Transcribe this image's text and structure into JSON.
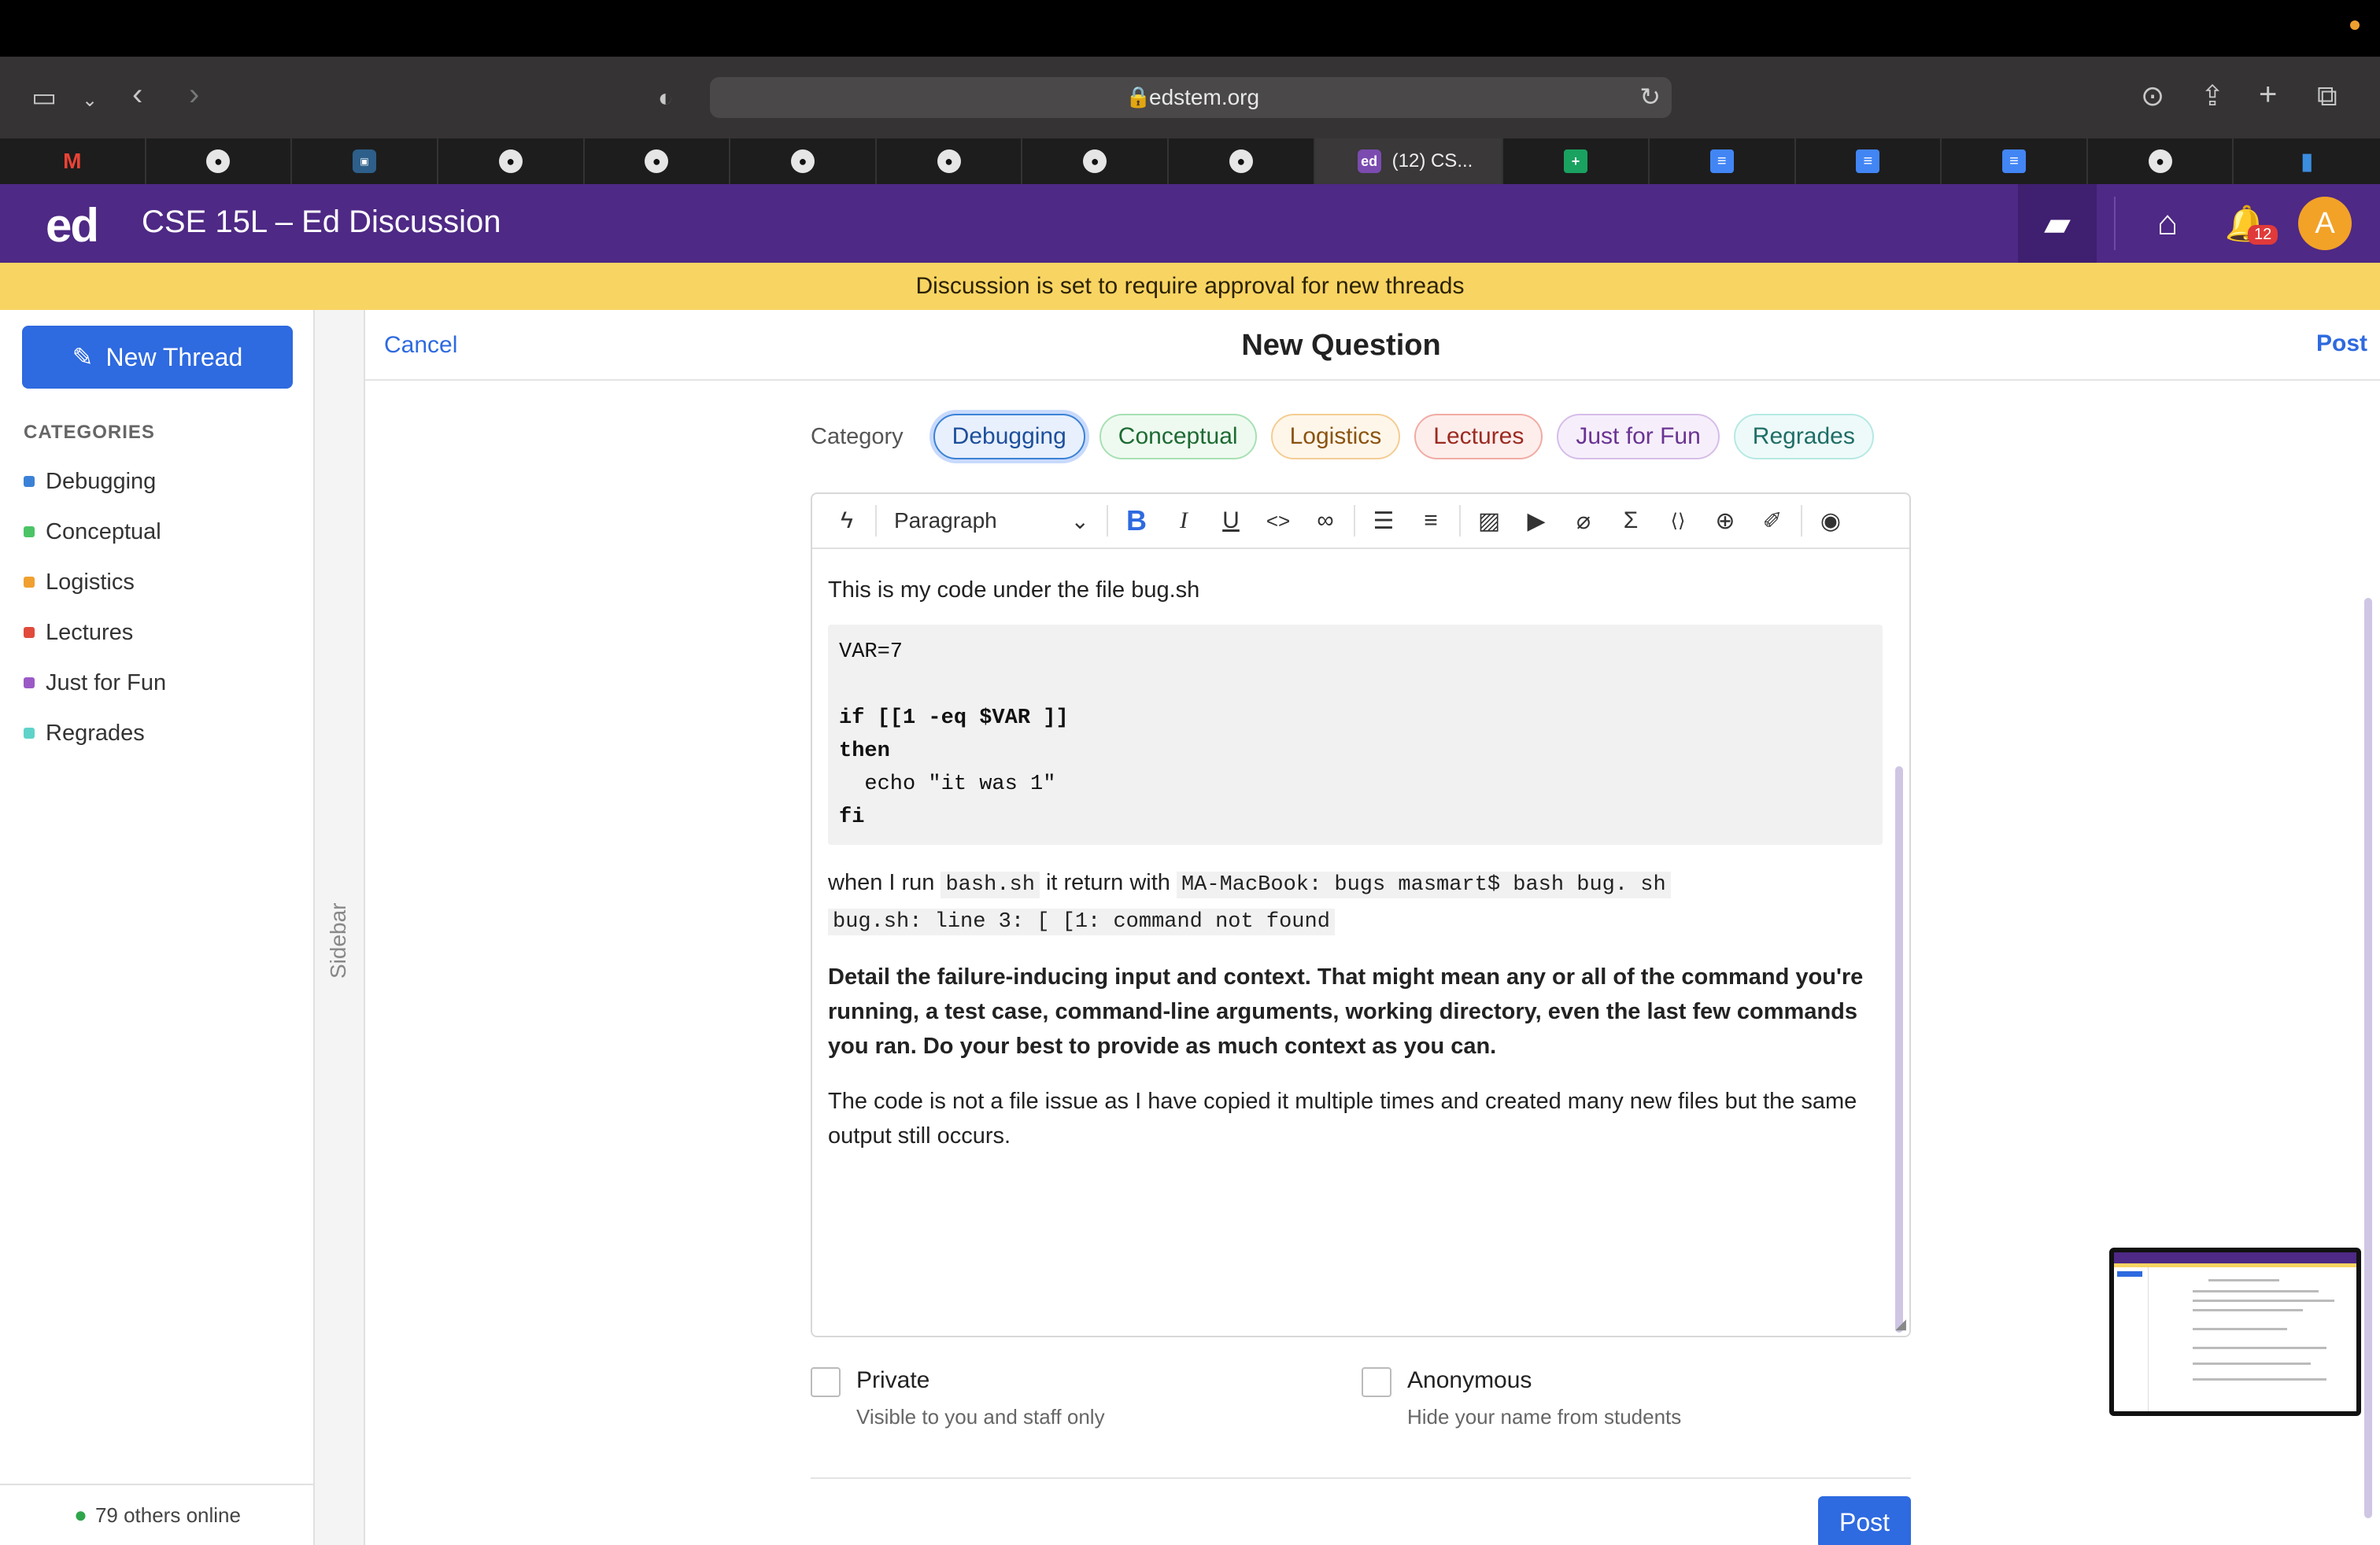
{
  "browser": {
    "url": "edstem.org",
    "active_tab_title": "(12) CS...",
    "tabs": [
      {
        "icon": "gmail-icon"
      },
      {
        "icon": "github-icon"
      },
      {
        "icon": "cse-icon"
      },
      {
        "icon": "github-icon"
      },
      {
        "icon": "github-icon"
      },
      {
        "icon": "github-icon"
      },
      {
        "icon": "github-icon"
      },
      {
        "icon": "github-icon"
      },
      {
        "icon": "github-icon"
      },
      {
        "icon": "ed-icon",
        "title": "(12) CS..."
      },
      {
        "icon": "sheets-icon"
      },
      {
        "icon": "docs-icon"
      },
      {
        "icon": "docs-icon"
      },
      {
        "icon": "docs-icon"
      },
      {
        "icon": "github-icon"
      },
      {
        "icon": "analytics-icon"
      }
    ]
  },
  "app": {
    "logo": "ed",
    "course_title": "CSE 15L – Ed Discussion",
    "notification_count": "12",
    "avatar_initial": "A",
    "accent": "#4e2985"
  },
  "notice": "Discussion is set to require approval for new threads",
  "sidebar": {
    "new_thread_label": "New Thread",
    "categories_heading": "CATEGORIES",
    "categories": [
      {
        "label": "Debugging",
        "color": "#3b82d6"
      },
      {
        "label": "Conceptual",
        "color": "#4cc466"
      },
      {
        "label": "Logistics",
        "color": "#f0a030"
      },
      {
        "label": "Lectures",
        "color": "#e04b3c"
      },
      {
        "label": "Just for Fun",
        "color": "#9b59c6"
      },
      {
        "label": "Regrades",
        "color": "#5fd3c8"
      }
    ],
    "rail_label": "Sidebar",
    "online_text": "79 others online"
  },
  "composer": {
    "cancel_label": "Cancel",
    "title": "New Question",
    "post_label": "Post",
    "category_label": "Category",
    "pills": [
      {
        "label": "Debugging",
        "selected": true
      },
      {
        "label": "Conceptual"
      },
      {
        "label": "Logistics"
      },
      {
        "label": "Lectures"
      },
      {
        "label": "Just for Fun"
      },
      {
        "label": "Regrades"
      }
    ],
    "paragraph_select": "Paragraph",
    "body": {
      "intro": "This is my code under the file bug.sh",
      "code_line1": "VAR=7",
      "code_if": "if",
      "code_if_rest": " [[1 -eq $VAR ]]",
      "code_then": "then",
      "code_echo": "  echo \"it was 1\"",
      "code_fi": "fi",
      "run_text1": "when I run ",
      "run_code1": "bash.sh",
      "run_text2": " it return with ",
      "run_code2": "MA-MacBook: bugs masmart$ bash bug. sh",
      "run_code3": "bug.sh: line 3: [ [1: command not found",
      "bold_para": "Detail the failure-inducing input and context. That might mean any or all of the command you're running, a test case, command-line arguments, working directory, even the last few commands you ran. Do your best to provide as much context as you can.",
      "last_para": "The code is not a file issue as I have copied it multiple times and created many new files but the same output still occurs."
    },
    "private_label": "Private",
    "private_sub": "Visible to you and staff only",
    "anonymous_label": "Anonymous",
    "anonymous_sub": "Hide your name from students",
    "post_button": "Post"
  }
}
